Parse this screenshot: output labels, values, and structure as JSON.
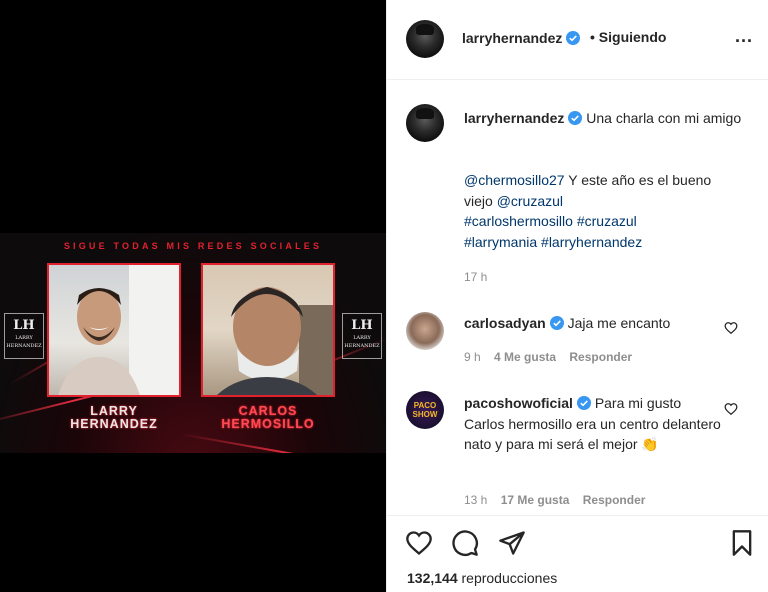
{
  "video": {
    "banner": "SIGUE TODAS MIS REDES SOCIALES",
    "person1": {
      "line1": "LARRY",
      "line2": "HERNANDEZ"
    },
    "person2": {
      "line1": "CARLOS",
      "line2": "HERMOSILLO"
    },
    "logo_mono": "LH",
    "logo_text_1": "LARRY",
    "logo_text_2": "HERNANDEZ"
  },
  "header": {
    "username": "larryhernandez",
    "separator": "•",
    "follow_label": "Siguiendo",
    "more": "..."
  },
  "caption": {
    "username": "larryhernandez",
    "text": "Una charla con mi amigo",
    "mention1": "@chermosillo27",
    "mid1": " Y este año es el bueno viejo ",
    "mention2": "@cruzazul",
    "tag1": "#carloshermosillo",
    "tag2": "#cruzazul",
    "tag3": "#larrymania",
    "tag4": "#larryhernandez",
    "time": "17 h"
  },
  "comments": [
    {
      "username": "carlosadyan",
      "text": "Jaja me encanto",
      "time": "9 h",
      "likes": "4 Me gusta",
      "reply": "Responder"
    },
    {
      "username": "pacoshowoficial",
      "text": "Para mi gusto Carlos hermosillo era un centro delantero nato y para mi será el mejor",
      "emoji": "👏",
      "avatar_text": "PACO SHOW",
      "time": "13 h",
      "likes": "17 Me gusta",
      "reply": "Responder"
    }
  ],
  "stats": {
    "views_count": "132,144",
    "views_label": "reproducciones"
  },
  "colors": {
    "verified_blue": "#3897f0",
    "link_blue": "#00376b",
    "promo_red": "#e1222e"
  },
  "icons": {
    "like": "heart-outline",
    "comment": "speech-bubble",
    "share": "paper-plane",
    "save": "bookmark"
  }
}
